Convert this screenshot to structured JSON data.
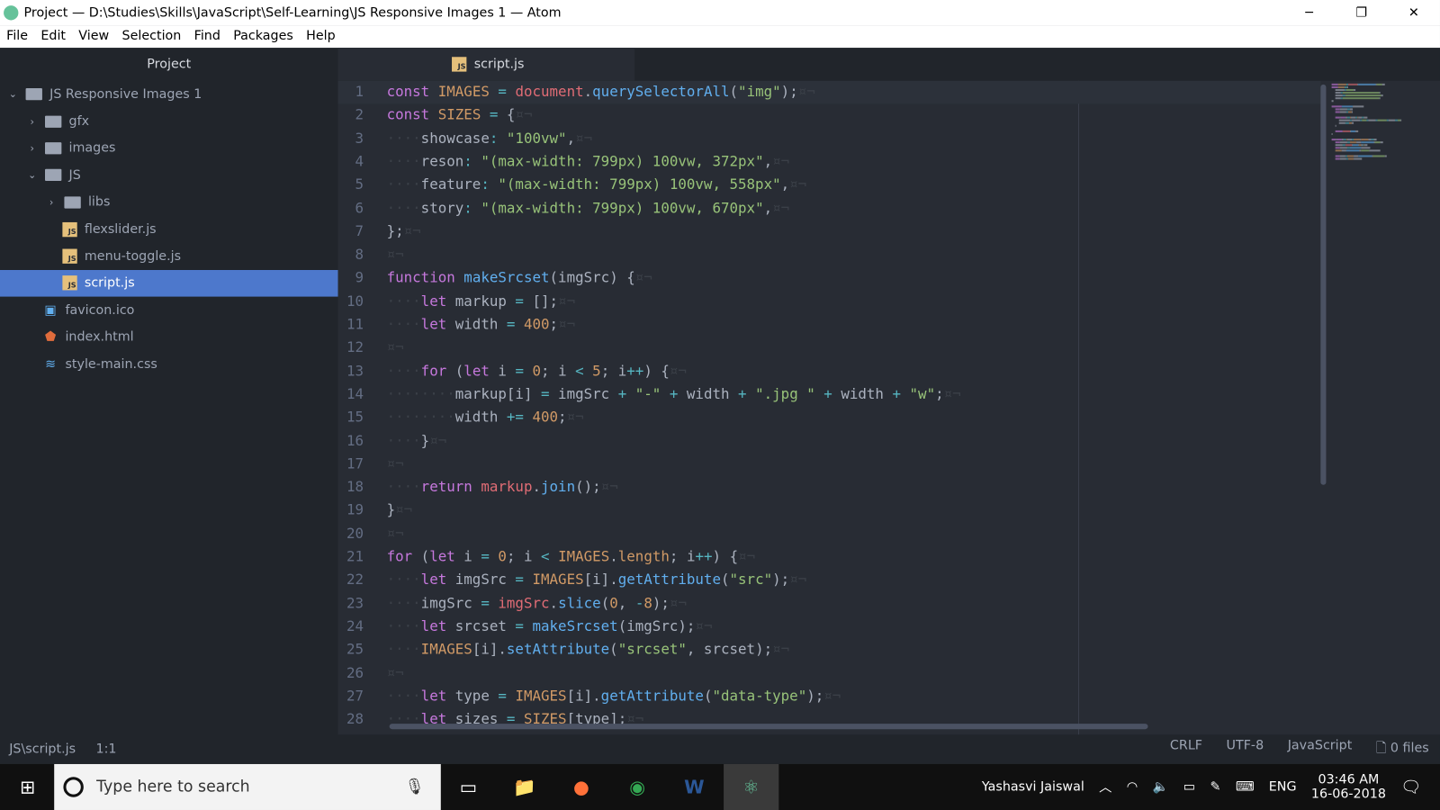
{
  "window": {
    "title": "Project — D:\\Studies\\Skills\\JavaScript\\Self-Learning\\JS Responsive Images 1 — Atom",
    "minimize": "─",
    "restore": "❐",
    "close": "✕"
  },
  "menu": [
    "File",
    "Edit",
    "View",
    "Selection",
    "Find",
    "Packages",
    "Help"
  ],
  "sidebar": {
    "title": "Project",
    "items": [
      {
        "label": "JS Responsive Images 1",
        "type": "folder",
        "level": 0,
        "expanded": true
      },
      {
        "label": "gfx",
        "type": "folder",
        "level": 1,
        "expanded": false
      },
      {
        "label": "images",
        "type": "folder",
        "level": 1,
        "expanded": false
      },
      {
        "label": "JS",
        "type": "folder",
        "level": 1,
        "expanded": true
      },
      {
        "label": "libs",
        "type": "folder",
        "level": 2,
        "expanded": false
      },
      {
        "label": "flexslider.js",
        "type": "js",
        "level": 2
      },
      {
        "label": "menu-toggle.js",
        "type": "js",
        "level": 2
      },
      {
        "label": "script.js",
        "type": "js",
        "level": 2,
        "selected": true
      },
      {
        "label": "favicon.ico",
        "type": "image",
        "level": 1
      },
      {
        "label": "index.html",
        "type": "html",
        "level": 1
      },
      {
        "label": "style-main.css",
        "type": "css",
        "level": 1
      }
    ]
  },
  "tab": {
    "label": "script.js",
    "icon_text": "JS"
  },
  "code": [
    {
      "n": 1,
      "ind": 0,
      "t": [
        [
          "k",
          "const "
        ],
        [
          "v",
          "IMAGES "
        ],
        [
          "o",
          "= "
        ],
        [
          "r",
          "document"
        ],
        [
          "p",
          "."
        ],
        [
          "f",
          "querySelectorAll"
        ],
        [
          "p",
          "("
        ],
        [
          "s",
          "\"img\""
        ],
        [
          "p",
          ");"
        ]
      ]
    },
    {
      "n": 2,
      "ind": 0,
      "t": [
        [
          "k",
          "const "
        ],
        [
          "v",
          "SIZES "
        ],
        [
          "o",
          "= "
        ],
        [
          "p",
          "{"
        ]
      ]
    },
    {
      "n": 3,
      "ind": 1,
      "t": [
        [
          "p",
          "showcase"
        ],
        [
          "o",
          ": "
        ],
        [
          "s",
          "\"100vw\""
        ],
        [
          "p",
          ","
        ]
      ]
    },
    {
      "n": 4,
      "ind": 1,
      "t": [
        [
          "p",
          "reson"
        ],
        [
          "o",
          ": "
        ],
        [
          "s",
          "\"(max-width: 799px) 100vw, 372px\""
        ],
        [
          "p",
          ","
        ]
      ]
    },
    {
      "n": 5,
      "ind": 1,
      "t": [
        [
          "p",
          "feature"
        ],
        [
          "o",
          ": "
        ],
        [
          "s",
          "\"(max-width: 799px) 100vw, 558px\""
        ],
        [
          "p",
          ","
        ]
      ]
    },
    {
      "n": 6,
      "ind": 1,
      "t": [
        [
          "p",
          "story"
        ],
        [
          "o",
          ": "
        ],
        [
          "s",
          "\"(max-width: 799px) 100vw, 670px\""
        ],
        [
          "p",
          ","
        ]
      ]
    },
    {
      "n": 7,
      "ind": 0,
      "t": [
        [
          "p",
          "};"
        ]
      ]
    },
    {
      "n": 8,
      "ind": 0,
      "t": []
    },
    {
      "n": 9,
      "ind": 0,
      "t": [
        [
          "k",
          "function "
        ],
        [
          "f",
          "makeSrcset"
        ],
        [
          "p",
          "(imgSrc) {"
        ]
      ]
    },
    {
      "n": 10,
      "ind": 1,
      "t": [
        [
          "k",
          "let "
        ],
        [
          "p",
          "markup "
        ],
        [
          "o",
          "= "
        ],
        [
          "p",
          "[];"
        ]
      ]
    },
    {
      "n": 11,
      "ind": 1,
      "t": [
        [
          "k",
          "let "
        ],
        [
          "p",
          "width "
        ],
        [
          "o",
          "= "
        ],
        [
          "n",
          "400"
        ],
        [
          "p",
          ";"
        ]
      ]
    },
    {
      "n": 12,
      "ind": 0,
      "t": []
    },
    {
      "n": 13,
      "ind": 1,
      "t": [
        [
          "k",
          "for "
        ],
        [
          "p",
          "("
        ],
        [
          "k",
          "let "
        ],
        [
          "p",
          "i "
        ],
        [
          "o",
          "= "
        ],
        [
          "n",
          "0"
        ],
        [
          "p",
          "; i "
        ],
        [
          "o",
          "< "
        ],
        [
          "n",
          "5"
        ],
        [
          "p",
          "; i"
        ],
        [
          "o",
          "++"
        ],
        [
          "p",
          ") {"
        ]
      ]
    },
    {
      "n": 14,
      "ind": 2,
      "t": [
        [
          "p",
          "markup[i] "
        ],
        [
          "o",
          "= "
        ],
        [
          "p",
          "imgSrc "
        ],
        [
          "o",
          "+ "
        ],
        [
          "s",
          "\"-\" "
        ],
        [
          "o",
          "+ "
        ],
        [
          "p",
          "width "
        ],
        [
          "o",
          "+ "
        ],
        [
          "s",
          "\".jpg \" "
        ],
        [
          "o",
          "+ "
        ],
        [
          "p",
          "width "
        ],
        [
          "o",
          "+ "
        ],
        [
          "s",
          "\"w\""
        ],
        [
          "p",
          ";"
        ]
      ]
    },
    {
      "n": 15,
      "ind": 2,
      "t": [
        [
          "p",
          "width "
        ],
        [
          "o",
          "+= "
        ],
        [
          "n",
          "400"
        ],
        [
          "p",
          ";"
        ]
      ]
    },
    {
      "n": 16,
      "ind": 1,
      "t": [
        [
          "p",
          "}"
        ]
      ]
    },
    {
      "n": 17,
      "ind": 0,
      "t": []
    },
    {
      "n": 18,
      "ind": 1,
      "t": [
        [
          "k",
          "return "
        ],
        [
          "r",
          "markup"
        ],
        [
          "p",
          "."
        ],
        [
          "f",
          "join"
        ],
        [
          "p",
          "();"
        ]
      ]
    },
    {
      "n": 19,
      "ind": 0,
      "t": [
        [
          "p",
          "}"
        ]
      ]
    },
    {
      "n": 20,
      "ind": 0,
      "t": []
    },
    {
      "n": 21,
      "ind": 0,
      "t": [
        [
          "k",
          "for "
        ],
        [
          "p",
          "("
        ],
        [
          "k",
          "let "
        ],
        [
          "p",
          "i "
        ],
        [
          "o",
          "= "
        ],
        [
          "n",
          "0"
        ],
        [
          "p",
          "; i "
        ],
        [
          "o",
          "< "
        ],
        [
          "v",
          "IMAGES"
        ],
        [
          "p",
          "."
        ],
        [
          "v",
          "length"
        ],
        [
          "p",
          "; i"
        ],
        [
          "o",
          "++"
        ],
        [
          "p",
          ") {"
        ]
      ]
    },
    {
      "n": 22,
      "ind": 1,
      "t": [
        [
          "k",
          "let "
        ],
        [
          "p",
          "imgSrc "
        ],
        [
          "o",
          "= "
        ],
        [
          "v",
          "IMAGES"
        ],
        [
          "p",
          "[i]."
        ],
        [
          "f",
          "getAttribute"
        ],
        [
          "p",
          "("
        ],
        [
          "s",
          "\"src\""
        ],
        [
          "p",
          ");"
        ]
      ]
    },
    {
      "n": 23,
      "ind": 1,
      "t": [
        [
          "p",
          "imgSrc "
        ],
        [
          "o",
          "= "
        ],
        [
          "r",
          "imgSrc"
        ],
        [
          "p",
          "."
        ],
        [
          "f",
          "slice"
        ],
        [
          "p",
          "("
        ],
        [
          "n",
          "0"
        ],
        [
          "p",
          ", "
        ],
        [
          "o",
          "-"
        ],
        [
          "n",
          "8"
        ],
        [
          "p",
          ");"
        ]
      ]
    },
    {
      "n": 24,
      "ind": 1,
      "t": [
        [
          "k",
          "let "
        ],
        [
          "p",
          "srcset "
        ],
        [
          "o",
          "= "
        ],
        [
          "f",
          "makeSrcset"
        ],
        [
          "p",
          "(imgSrc);"
        ]
      ]
    },
    {
      "n": 25,
      "ind": 1,
      "t": [
        [
          "v",
          "IMAGES"
        ],
        [
          "p",
          "[i]."
        ],
        [
          "f",
          "setAttribute"
        ],
        [
          "p",
          "("
        ],
        [
          "s",
          "\"srcset\""
        ],
        [
          "p",
          ", srcset);"
        ]
      ]
    },
    {
      "n": 26,
      "ind": 0,
      "t": []
    },
    {
      "n": 27,
      "ind": 1,
      "t": [
        [
          "k",
          "let "
        ],
        [
          "p",
          "type "
        ],
        [
          "o",
          "= "
        ],
        [
          "v",
          "IMAGES"
        ],
        [
          "p",
          "[i]."
        ],
        [
          "f",
          "getAttribute"
        ],
        [
          "p",
          "("
        ],
        [
          "s",
          "\"data-type\""
        ],
        [
          "p",
          ");"
        ]
      ]
    },
    {
      "n": 28,
      "ind": 1,
      "t": [
        [
          "k",
          "let "
        ],
        [
          "p",
          "sizes "
        ],
        [
          "o",
          "= "
        ],
        [
          "v",
          "SIZES"
        ],
        [
          "p",
          "[type];"
        ]
      ]
    }
  ],
  "invisibles": "¤¬",
  "status": {
    "path": "JS\\script.js",
    "cursor": "1:1",
    "line_ending": "CRLF",
    "encoding": "UTF-8",
    "grammar": "JavaScript",
    "files": "0 files"
  },
  "taskbar": {
    "search_placeholder": "Type here to search",
    "user": "Yashasvi Jaiswal",
    "lang": "ENG",
    "time": "03:46 AM",
    "date": "16-06-2018"
  }
}
